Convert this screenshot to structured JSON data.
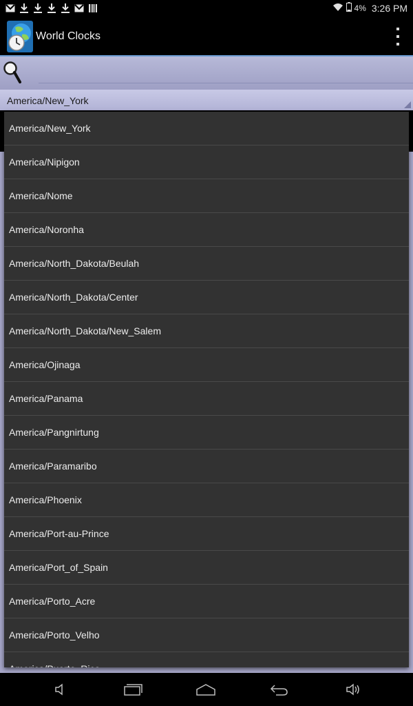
{
  "status_bar": {
    "time": "3:26 PM",
    "battery": "4%"
  },
  "app": {
    "title": "World Clocks"
  },
  "search": {
    "value": "",
    "placeholder": ""
  },
  "spinner": {
    "selected": "America/New_York"
  },
  "timezones": [
    "America/New_York",
    "America/Nipigon",
    "America/Nome",
    "America/Noronha",
    "America/North_Dakota/Beulah",
    "America/North_Dakota/Center",
    "America/North_Dakota/New_Salem",
    "America/Ojinaga",
    "America/Panama",
    "America/Pangnirtung",
    "America/Paramaribo",
    "America/Phoenix",
    "America/Port-au-Prince",
    "America/Port_of_Spain",
    "America/Porto_Acre",
    "America/Porto_Velho",
    "America/Puerto_Rico"
  ],
  "colors": {
    "accent": "#6b9bd1",
    "list_bg": "#323232",
    "search_bg": "#b7b9d8"
  },
  "icons": {
    "status": [
      "gmail-icon",
      "download-icon",
      "download-icon",
      "download-icon",
      "download-icon",
      "gmail-icon",
      "barcode-icon"
    ],
    "nav": [
      "volume-down-icon",
      "recent-apps-icon",
      "home-icon",
      "back-icon",
      "volume-up-icon"
    ]
  }
}
